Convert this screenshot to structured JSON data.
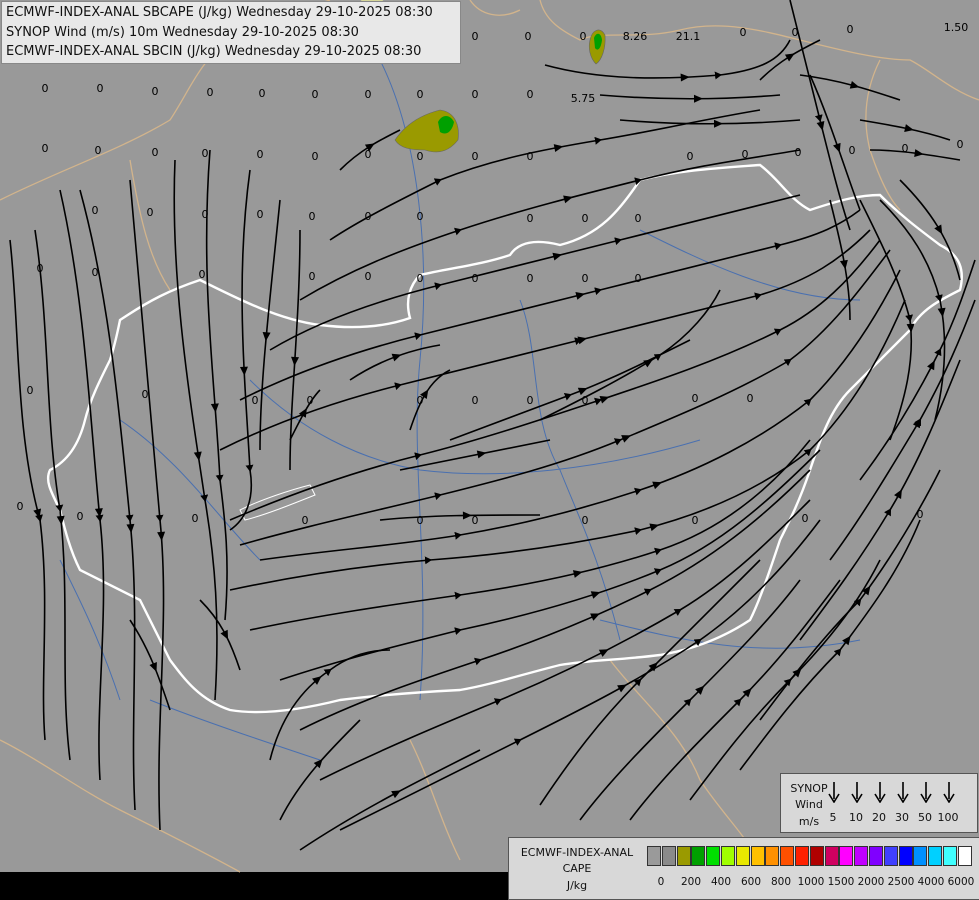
{
  "titles": [
    "ECMWF-INDEX-ANAL SBCAPE (J/kg) Wednesday 29-10-2025 08:30",
    "SYNOP Wind (m/s) 10m Wednesday 29-10-2025 08:30",
    "ECMWF-INDEX-ANAL SBCIN (J/kg) Wednesday 29-10-2025 08:30"
  ],
  "station_values": [
    {
      "v": "8.26"
    },
    {
      "v": "21.1"
    },
    {
      "v": "5.75"
    },
    {
      "v": "1.50"
    },
    {
      "v": "0"
    },
    {
      "v": "0"
    },
    {
      "v": "0"
    },
    {
      "v": "0"
    },
    {
      "v": "0"
    },
    {
      "v": "0"
    },
    {
      "v": "0"
    },
    {
      "v": "0"
    },
    {
      "v": "0"
    },
    {
      "v": "0"
    },
    {
      "v": "0"
    },
    {
      "v": "0"
    },
    {
      "v": "0"
    },
    {
      "v": "0"
    },
    {
      "v": "0"
    },
    {
      "v": "0"
    },
    {
      "v": "0"
    },
    {
      "v": "0"
    },
    {
      "v": "0"
    },
    {
      "v": "0"
    },
    {
      "v": "0"
    },
    {
      "v": "0"
    },
    {
      "v": "0"
    },
    {
      "v": "0"
    },
    {
      "v": "0"
    },
    {
      "v": "0"
    },
    {
      "v": "0"
    },
    {
      "v": "0"
    },
    {
      "v": "0"
    },
    {
      "v": "0"
    },
    {
      "v": "0"
    },
    {
      "v": "0"
    },
    {
      "v": "0"
    },
    {
      "v": "0"
    },
    {
      "v": "0"
    },
    {
      "v": "0"
    },
    {
      "v": "0"
    },
    {
      "v": "0"
    },
    {
      "v": "0"
    },
    {
      "v": "0"
    },
    {
      "v": "0"
    },
    {
      "v": "0"
    },
    {
      "v": "0"
    },
    {
      "v": "0"
    },
    {
      "v": "0"
    },
    {
      "v": "0"
    },
    {
      "v": "0"
    },
    {
      "v": "0"
    },
    {
      "v": "0"
    },
    {
      "v": "0"
    },
    {
      "v": "0"
    },
    {
      "v": "0"
    },
    {
      "v": "0"
    },
    {
      "v": "0"
    },
    {
      "v": "0"
    },
    {
      "v": "0"
    },
    {
      "v": "0"
    },
    {
      "v": "0"
    },
    {
      "v": "0"
    },
    {
      "v": "0"
    },
    {
      "v": "0"
    },
    {
      "v": "0"
    },
    {
      "v": "0"
    },
    {
      "v": "0"
    },
    {
      "v": "0"
    },
    {
      "v": "0"
    },
    {
      "v": "0"
    },
    {
      "v": "0"
    },
    {
      "v": "0"
    },
    {
      "v": "0"
    },
    {
      "v": "0"
    },
    {
      "v": "0"
    }
  ],
  "synop_legend": {
    "title_line1": "SYNOP",
    "title_line2": "Wind",
    "unit": "m/s",
    "speeds": [
      "5",
      "10",
      "20",
      "30",
      "50",
      "100"
    ]
  },
  "cape_legend": {
    "title_line1": "ECMWF-INDEX-ANAL",
    "title_line2": "CAPE",
    "unit": "J/kg",
    "colors": [
      "#9a9a9a",
      "#8a8a8a",
      "#9a9a00",
      "#00a000",
      "#00e000",
      "#a0ff00",
      "#e8e800",
      "#ffc000",
      "#ff9000",
      "#ff5000",
      "#ff2000",
      "#b00000",
      "#d00060",
      "#ff00ff",
      "#c000ff",
      "#8000ff",
      "#4040ff",
      "#0000ff",
      "#0090ff",
      "#00d0ff",
      "#40ffff",
      "#ffffff"
    ],
    "ticks": [
      "0",
      "200",
      "400",
      "600",
      "800",
      "1000",
      "1500",
      "2000",
      "2500",
      "4000",
      "6000"
    ]
  },
  "colors": {
    "background": "#999999",
    "streamline": "#000000",
    "border_main": "#ffffff",
    "border_other": "#d2b48c",
    "river": "#4a70b0"
  }
}
